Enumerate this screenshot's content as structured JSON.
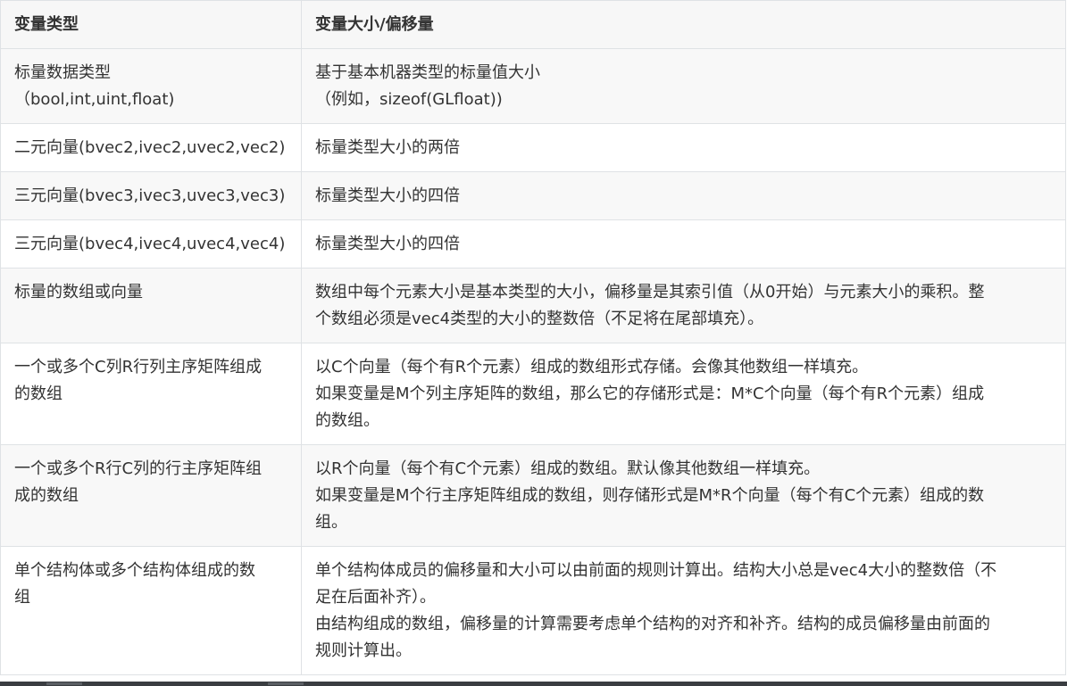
{
  "table": {
    "headers": [
      "变量类型",
      "变量大小/偏移量"
    ],
    "rows": [
      {
        "type": [
          "标量数据类型",
          "（bool,int,uint,float)"
        ],
        "size": [
          "基于基本机器类型的标量值大小",
          "（例如，sizeof(GLfloat))"
        ]
      },
      {
        "type": [
          "二元向量(bvec2,ivec2,uvec2,vec2)"
        ],
        "size": [
          "标量类型大小的两倍"
        ]
      },
      {
        "type": [
          "三元向量(bvec3,ivec3,uvec3,vec3)"
        ],
        "size": [
          "标量类型大小的四倍"
        ]
      },
      {
        "type": [
          "三元向量(bvec4,ivec4,uvec4,vec4)"
        ],
        "size": [
          "标量类型大小的四倍"
        ]
      },
      {
        "type": [
          "标量的数组或向量"
        ],
        "size": [
          "数组中每个元素大小是基本类型的大小，偏移量是其索引值（从0开始）与元素大小的乘积。整",
          "个数组必须是vec4类型的大小的整数倍（不足将在尾部填充）。"
        ]
      },
      {
        "type": [
          "一个或多个C列R行列主序矩阵组成",
          "的数组"
        ],
        "size": [
          "以C个向量（每个有R个元素）组成的数组形式存储。会像其他数组一样填充。",
          "如果变量是M个列主序矩阵的数组，那么它的存储形式是：M*C个向量（每个有R个元素）组成",
          "的数组。"
        ]
      },
      {
        "type": [
          "一个或多个R行C列的行主序矩阵组",
          "成的数组"
        ],
        "size": [
          "以R个向量（每个有C个元素）组成的数组。默认像其他数组一样填充。",
          "如果变量是M个行主序矩阵组成的数组，则存储形式是M*R个向量（每个有C个元素）组成的数",
          "组。"
        ]
      },
      {
        "type": [
          "单个结构体或多个结构体组成的数",
          "组"
        ],
        "size": [
          "单个结构体成员的偏移量和大小可以由前面的规则计算出。结构大小总是vec4大小的整数倍（不",
          "足在后面补齐）。",
          "由结构组成的数组，偏移量的计算需要考虑单个结构的对齐和补齐。结构的成员偏移量由前面的",
          "规则计算出。"
        ]
      }
    ]
  }
}
